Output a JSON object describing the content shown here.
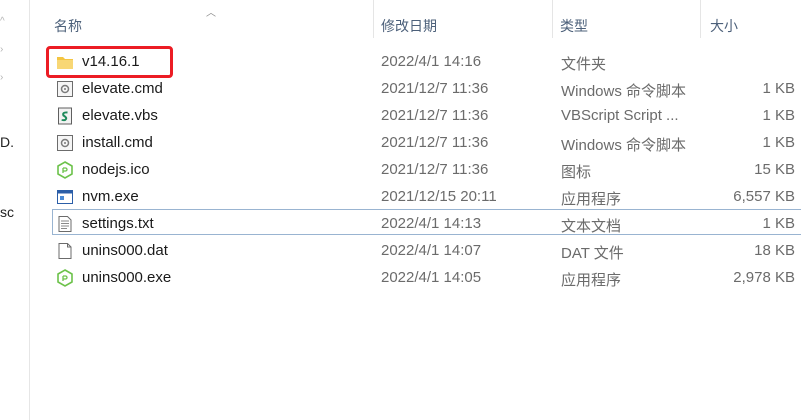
{
  "columns": {
    "name": "名称",
    "date": "修改日期",
    "type": "类型",
    "size": "大小"
  },
  "nav_fragments": [
    "D.",
    "sc"
  ],
  "files": [
    {
      "name": "v14.16.1",
      "date": "2022/4/1 14:16",
      "type": "文件夹",
      "size": "",
      "icon": "folder-icon",
      "highlighted": true
    },
    {
      "name": "elevate.cmd",
      "date": "2021/12/7 11:36",
      "type": "Windows 命令脚本",
      "size": "1 KB",
      "icon": "cmd-script-icon"
    },
    {
      "name": "elevate.vbs",
      "date": "2021/12/7 11:36",
      "type": "VBScript Script ...",
      "size": "1 KB",
      "icon": "vbs-script-icon"
    },
    {
      "name": "install.cmd",
      "date": "2021/12/7 11:36",
      "type": "Windows 命令脚本",
      "size": "1 KB",
      "icon": "cmd-script-icon"
    },
    {
      "name": "nodejs.ico",
      "date": "2021/12/7 11:36",
      "type": "图标",
      "size": "15 KB",
      "icon": "nodejs-icon"
    },
    {
      "name": "nvm.exe",
      "date": "2021/12/15 20:11",
      "type": "应用程序",
      "size": "6,557 KB",
      "icon": "exe-window-icon"
    },
    {
      "name": "settings.txt",
      "date": "2022/4/1 14:13",
      "type": "文本文档",
      "size": "1 KB",
      "icon": "text-file-icon"
    },
    {
      "name": "unins000.dat",
      "date": "2022/4/1 14:07",
      "type": "DAT 文件",
      "size": "18 KB",
      "icon": "blank-file-icon"
    },
    {
      "name": "unins000.exe",
      "date": "2022/4/1 14:05",
      "type": "应用程序",
      "size": "2,978 KB",
      "icon": "nodejs-icon"
    }
  ],
  "colors": {
    "header_text": "#4c607a",
    "highlight": "#ec1c24",
    "focus_border": "#99b4d1",
    "folder": "#f4c542"
  }
}
